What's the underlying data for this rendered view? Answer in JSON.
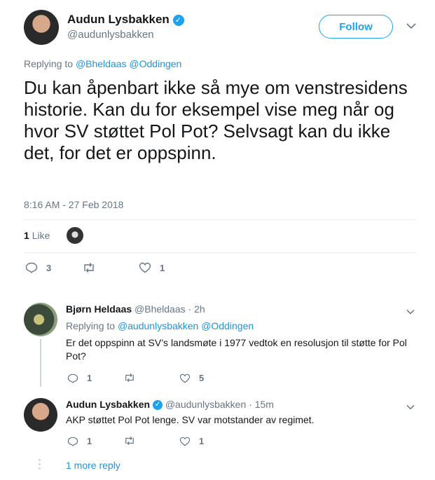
{
  "main_tweet": {
    "author_name": "Audun Lysbakken",
    "author_handle": "@audunlysbakken",
    "follow_label": "Follow",
    "replying_prefix": "Replying to",
    "replying_to": "@Bheldaas @Oddingen",
    "text": "Du kan åpenbart ikke så mye om venstresidens historie. Kan du for eksempel vise meg når og hvor SV støttet Pol Pot? Selvsagt kan du ikke det, for det er oppspinn.",
    "timestamp": "8:16 AM - 27 Feb 2018",
    "likes_count": "1",
    "likes_label": "Like",
    "reply_count": "3",
    "retweet_count": "",
    "like_count": "1"
  },
  "replies": [
    {
      "author_name": "Bjørn Heldaas",
      "author_handle": "@Bheldaas",
      "time": "· 2h",
      "replying_prefix": "Replying to",
      "replying_to": "@audunlysbakken @Oddingen",
      "text": "Er det oppspinn at SV’s landsmøte i 1977 vedtok en resolusjon til støtte for Pol Pot?",
      "reply_count": "1",
      "like_count": "5"
    },
    {
      "author_name": "Audun Lysbakken",
      "author_handle": "@audunlysbakken",
      "time": "· 15m",
      "text": "AKP støttet Pol Pot lenge. SV var motstander av regimet.",
      "reply_count": "1",
      "like_count": "1"
    }
  ],
  "more_replies_label": "1 more reply",
  "colors": {
    "accent": "#1da1f2",
    "link": "#1b95e0",
    "muted": "#657786",
    "divider": "#e6ecf0"
  }
}
